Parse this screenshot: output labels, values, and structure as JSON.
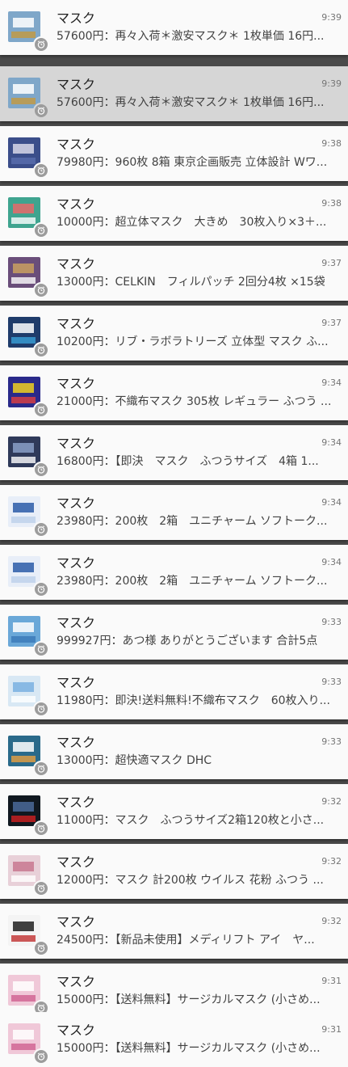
{
  "notifications": [
    {
      "app": "マスク",
      "time": "9:39",
      "text": "57600円：再々入荷＊激安マスク＊ 1枚単価 16円...",
      "thumb": [
        "#7fa7c9",
        "#ffffff",
        "#c59a3e"
      ]
    },
    {
      "app": "マスク",
      "time": "9:39",
      "text": "57600円：再々入荷＊激安マスク＊ 1枚単価 16円...",
      "thumb": [
        "#7fa7c9",
        "#ffffff",
        "#c59a3e"
      ]
    },
    {
      "app": "マスク",
      "time": "9:38",
      "text": "79980円：960枚 8箱 東京企画販売 立体設計 Wワ...",
      "thumb": [
        "#3b4e8a",
        "#d8d8e8",
        "#5b6fae"
      ]
    },
    {
      "app": "マスク",
      "time": "9:38",
      "text": "10000円：超立体マスク　大きめ　30枚入り×3＋...",
      "thumb": [
        "#3fa48f",
        "#e96a6a",
        "#ffffff"
      ]
    },
    {
      "app": "マスク",
      "time": "9:37",
      "text": "13000円：CELKIN　フィルパッチ 2回分4枚 ×15袋",
      "thumb": [
        "#6a4e7a",
        "#c9a060",
        "#ffffff"
      ]
    },
    {
      "app": "マスク",
      "time": "9:37",
      "text": "10200円：リブ・ラボラトリーズ 立体型 マスク ふ...",
      "thumb": [
        "#1f3c6b",
        "#ffffff",
        "#3aa0d8"
      ]
    },
    {
      "app": "マスク",
      "time": "9:34",
      "text": "21000円：不織布マスク 305枚 レギュラー ふつう ...",
      "thumb": [
        "#2a2a8a",
        "#f0d020",
        "#e04040"
      ]
    },
    {
      "app": "マスク",
      "time": "9:34",
      "text": "16800円：【即決　マスク　ふつうサイズ　4箱 1...",
      "thumb": [
        "#2f3a5a",
        "#8aa0c8",
        "#ffffff"
      ]
    },
    {
      "app": "マスク",
      "time": "9:34",
      "text": "23980円：200枚　2箱　ユニチャーム ソフトーク...",
      "thumb": [
        "#e8eef8",
        "#2a5aa8",
        "#bcd0ea"
      ]
    },
    {
      "app": "マスク",
      "time": "9:34",
      "text": "23980円：200枚　2箱　ユニチャーム ソフトーク...",
      "thumb": [
        "#e8eef8",
        "#2a5aa8",
        "#bcd0ea"
      ]
    },
    {
      "app": "マスク",
      "time": "9:33",
      "text": "999927円：あつ様 ありがとうございます 合計5点",
      "thumb": [
        "#6aa8d8",
        "#ffffff",
        "#3a78b8"
      ]
    },
    {
      "app": "マスク",
      "time": "9:33",
      "text": "11980円：即決!送料無料!不織布マスク　60枚入り...",
      "thumb": [
        "#d8e8f4",
        "#7ab0e0",
        "#ffffff"
      ]
    },
    {
      "app": "マスク",
      "time": "9:33",
      "text": "13000円：超快適マスク DHC",
      "thumb": [
        "#2a6a8a",
        "#ffffff",
        "#e8a040"
      ]
    },
    {
      "app": "マスク",
      "time": "9:32",
      "text": "11000円：マスク　ふつうサイズ2箱120枚と小さ...",
      "thumb": [
        "#101820",
        "#4a6a9a",
        "#d02020"
      ]
    },
    {
      "app": "マスク",
      "time": "9:32",
      "text": "12000円：マスク 計200枚 ウイルス 花粉 ふつう ...",
      "thumb": [
        "#e8d0d8",
        "#c87890",
        "#ffffff"
      ]
    },
    {
      "app": "マスク",
      "time": "9:32",
      "text": "24500円：【新品未使用】メディリフト アイ　ヤ...",
      "thumb": [
        "#f4f4f4",
        "#202020",
        "#c03030"
      ]
    },
    {
      "app": "マスク",
      "time": "9:31",
      "text": "15000円：【送料無料】サージカルマスク (小さめ...",
      "thumb": [
        "#f0c8d8",
        "#ffffff",
        "#d06090"
      ]
    },
    {
      "app": "マスク",
      "time": "9:31",
      "text": "15000円：【送料無料】サージカルマスク (小さめ...",
      "thumb": [
        "#f0c8d8",
        "#ffffff",
        "#d06090"
      ]
    }
  ],
  "colors": {
    "card": "#fafafa",
    "card_active": "#d6d6d6",
    "badge": "#9c9c9c",
    "backdrop": "#4a4a4a"
  },
  "icons": {
    "app_badge": "alarm-clock-icon",
    "thumbnail": "product-photo"
  }
}
